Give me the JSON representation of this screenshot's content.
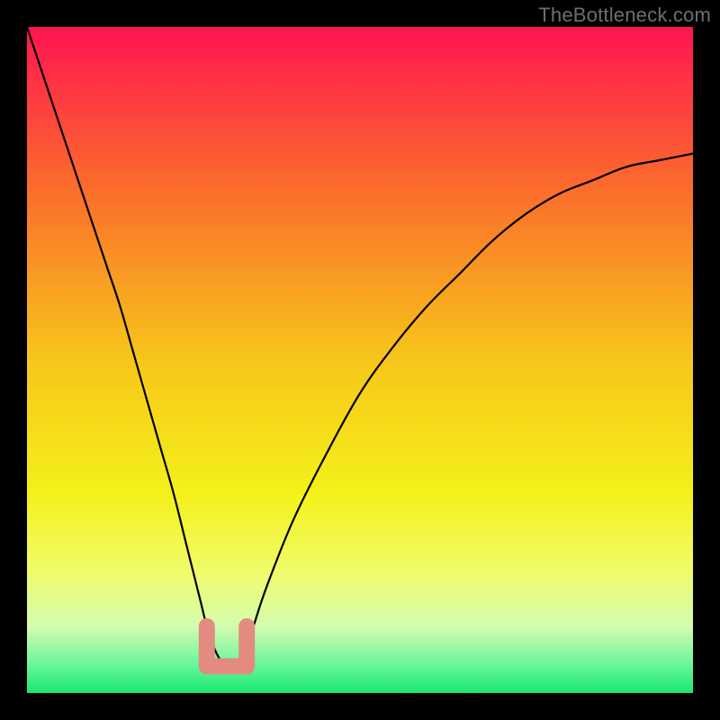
{
  "watermark": "TheBottleneck.com",
  "chart_data": {
    "type": "line",
    "title": "",
    "xlabel": "",
    "ylabel": "",
    "xlim": [
      0,
      100
    ],
    "ylim": [
      0,
      100
    ],
    "grid": false,
    "legend": false,
    "background_gradient": {
      "stops": [
        {
          "offset": 0.0,
          "color": "#ff1450"
        },
        {
          "offset": 0.25,
          "color": "#fb6f2b"
        },
        {
          "offset": 0.5,
          "color": "#f7c61a"
        },
        {
          "offset": 0.7,
          "color": "#f4f11a"
        },
        {
          "offset": 0.82,
          "color": "#f0fc6c"
        },
        {
          "offset": 0.9,
          "color": "#d4fcb0"
        },
        {
          "offset": 0.96,
          "color": "#66f59a"
        },
        {
          "offset": 1.0,
          "color": "#17e86e"
        }
      ]
    },
    "series": [
      {
        "name": "bottleneck-curve",
        "x": [
          0,
          2,
          4,
          6,
          8,
          10,
          12,
          14,
          16,
          18,
          20,
          22,
          24,
          26,
          27,
          28,
          29,
          30,
          31,
          32,
          33,
          34,
          36,
          40,
          45,
          50,
          55,
          60,
          65,
          70,
          75,
          80,
          85,
          90,
          95,
          100
        ],
        "y": [
          100,
          94,
          88,
          82,
          76,
          70,
          64,
          58,
          51,
          44,
          37,
          30,
          22,
          14,
          10,
          7,
          5,
          4,
          4,
          5,
          7,
          10,
          16,
          26,
          36,
          45,
          52,
          58,
          63,
          68,
          72,
          75,
          77,
          79,
          80,
          81
        ]
      }
    ],
    "annotations": [
      {
        "name": "optimal-marker",
        "shape": "u",
        "color": "#e38b80",
        "center_x": 30,
        "left_x": 27,
        "right_x": 33,
        "bottom_y": 4,
        "top_y": 10
      }
    ]
  }
}
